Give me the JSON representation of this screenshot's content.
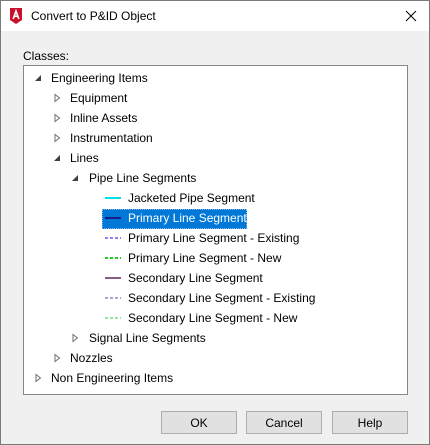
{
  "window": {
    "title": "Convert to P&ID Object",
    "app_icon": "autocad-icon",
    "close_icon": "close-icon"
  },
  "classes_label": "Classes:",
  "tree": {
    "engineering_items": "Engineering Items",
    "equipment": "Equipment",
    "inline_assets": "Inline Assets",
    "instrumentation": "Instrumentation",
    "lines": "Lines",
    "pipe_line_segments": "Pipe Line Segments",
    "segments": [
      {
        "label": "Jacketed Pipe Segment",
        "color": "#00e0e0",
        "style": "solid"
      },
      {
        "label": "Primary Line Segment",
        "color": "#1a1a8c",
        "style": "solid"
      },
      {
        "label": "Primary Line Segment - Existing",
        "color": "#9a7cf0",
        "style": "dashed"
      },
      {
        "label": "Primary Line Segment - New",
        "color": "#22cc22",
        "style": "dashed"
      },
      {
        "label": "Secondary Line Segment",
        "color": "#8a5a8a",
        "style": "solid"
      },
      {
        "label": "Secondary Line Segment - Existing",
        "color": "#a8a8c8",
        "style": "dashed"
      },
      {
        "label": "Secondary Line Segment - New",
        "color": "#9be59b",
        "style": "dashed"
      }
    ],
    "selected_segment": "Primary Line Segment",
    "signal_line_segments": "Signal Line Segments",
    "nozzles": "Nozzles",
    "non_engineering_items": "Non Engineering Items"
  },
  "buttons": {
    "ok": "OK",
    "cancel": "Cancel",
    "help": "Help"
  },
  "colors": {
    "selection": "#0078d7",
    "dialog_bg": "#f0f0f0",
    "brand_red": "#c8102e"
  }
}
